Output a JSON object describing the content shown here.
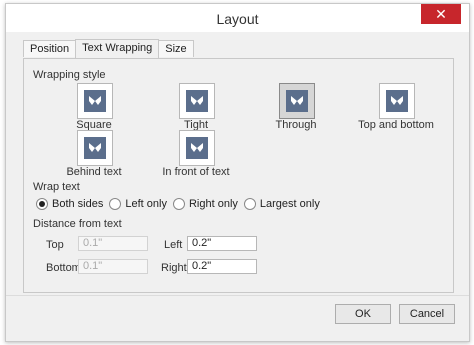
{
  "window": {
    "title": "Layout",
    "close_glyph": "✕"
  },
  "tabs": [
    {
      "label": "Position"
    },
    {
      "label": "Text Wrapping"
    },
    {
      "label": "Size"
    }
  ],
  "wrapping_style": {
    "label": "Wrapping style",
    "options": [
      {
        "label": "Square",
        "icon": "butterfly-icon"
      },
      {
        "label": "Tight",
        "icon": "butterfly-icon"
      },
      {
        "label": "Through",
        "icon": "butterfly-icon",
        "selected": true
      },
      {
        "label": "Top and bottom",
        "icon": "butterfly-icon"
      },
      {
        "label": "Behind text",
        "icon": "butterfly-icon"
      },
      {
        "label": "In front of text",
        "icon": "butterfly-icon"
      }
    ]
  },
  "wrap_text": {
    "label": "Wrap text",
    "options": [
      {
        "label": "Both sides",
        "checked": true
      },
      {
        "label": "Left only",
        "checked": false
      },
      {
        "label": "Right only",
        "checked": false
      },
      {
        "label": "Largest only",
        "checked": false
      }
    ]
  },
  "distance": {
    "label": "Distance from text",
    "top_label": "Top",
    "top_value": "0.1\"",
    "bottom_label": "Bottom",
    "bottom_value": "0.1\"",
    "left_label": "Left",
    "left_value": "0.2\"",
    "right_label": "Right",
    "right_value": "0.2\""
  },
  "buttons": {
    "ok": "OK",
    "cancel": "Cancel"
  },
  "colors": {
    "close": "#c7262c",
    "icon_fill": "#5b6e8c",
    "icon_bg": "#d8e3f2"
  }
}
